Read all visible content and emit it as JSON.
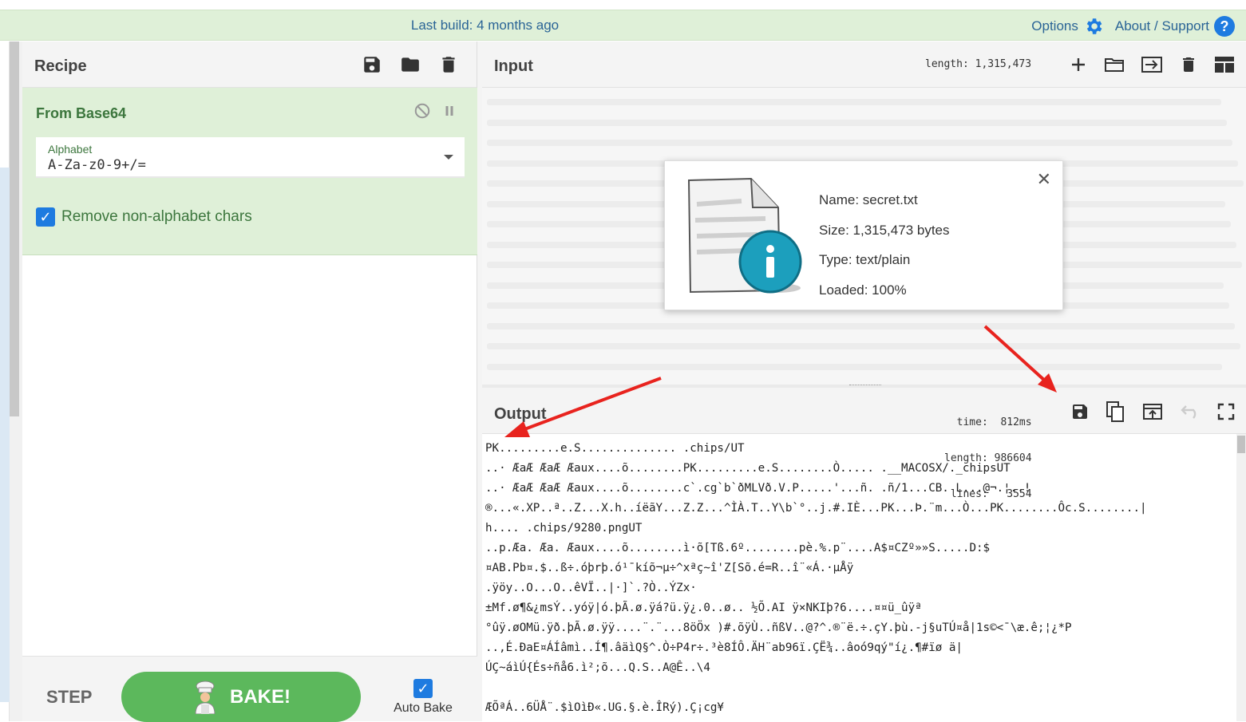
{
  "banner": {
    "build_text": "Last build: 4 months ago",
    "options_label": "Options",
    "about_label": "About / Support",
    "help_glyph": "?"
  },
  "recipe": {
    "title": "Recipe",
    "tools": [
      "save-icon",
      "folder-icon",
      "trash-icon"
    ],
    "operation": {
      "name": "From Base64",
      "alphabet_label": "Alphabet",
      "alphabet_value": "A-Za-z0-9+/=",
      "remove_label": "Remove non-alphabet chars",
      "remove_checked": true
    },
    "step_label": "STEP",
    "bake_label": "BAKE!",
    "autobake_label": "Auto Bake",
    "autobake_checked": true
  },
  "input": {
    "title": "Input",
    "length_stat": "length: 1,315,473",
    "tools": [
      "plus-icon",
      "folder-icon",
      "import-icon",
      "trash-icon",
      "layout-icon"
    ]
  },
  "file_popup": {
    "name_line": "Name: secret.txt",
    "size_line": "Size: 1,315,473 bytes",
    "type_line": "Type: text/plain",
    "loaded_line": "Loaded: 100%",
    "close_glyph": "✕"
  },
  "output": {
    "title": "Output",
    "time_stat": "  time:  812ms",
    "length_stat": "length: 986604",
    "lines_stat": " lines:   3554",
    "tools": [
      "save-icon",
      "copy-icon",
      "replace-input-icon",
      "undo-icon",
      "fullscreen-icon"
    ],
    "lines": [
      "PK.........e.S.............. .chips/UT",
      "..· ÆaÆ ÆaÆ Æaux....õ........PK.........e.S........Ò..... .__MACOSX/._chipsUT",
      "..· ÆaÆ ÆaÆ Æaux....õ........c`.cg`b`ðMLVð.V.P.....'...ñ. .ñ/1...CB. L...@¬.¦..!",
      "®...«.XP..ª..Z...X.h..íëãY...Z.Z...^ÌÀ.T..Y\\b`°..j.#.IÈ...PK...Þ.¨m...Ò...PK........Ôc.S........|",
      "h.... .chips/9280.pngUT",
      "..p.Æa. Æa. Æaux....õ........ì·õ[Tß.6º........pè.%.p¨....A$¤CZº»»S.....D:$",
      "¤AB.Pb¤.$..ß÷.óþrþ.ó¹¯kíõ¬µ÷^xªç~î'Z[Sõ.é=R..î¨«Á.·µÅÿ",
      ".ÿöy..O...O..êVÏ..|·]`.?Ò..ÝZx·",
      "±Mf.ø¶&¿msÝ..yóÿ|ó.þÃ.ø.ÿá?ü.ÿ¿.0..ø.. ½Õ.AI ÿ×NKIþ?6....¤¤ü_ûÿª",
      "°ûÿ.øOMü.ÿð.þÃ.ø.ÿÿ....¨.¨...8öÖx )#.õÿÙ..ñßV..@?^.®¨ë.÷.çY.þù.-j§uTÚ¤å|1s©<¯\\æ.ê;¦¿*P",
      "..,É.ÐaE¤ÁÍâmì..Í¶.âäìQ§^.Ò÷P4r÷.³è8ÍÔ.ÄH¨ab96ï.ÇË¾..âoó9qý\"í¿.¶#ïø ä|",
      "ÚÇ~áìÚ{És÷ñå6.ì²;õ...Q.S..A@Ê..\\4",
      "",
      "ÆÕªÁ..6ÜÅ¨.$ìOìÐ«.UG.§.è.ÎRý).Ç¡cg¥"
    ]
  }
}
